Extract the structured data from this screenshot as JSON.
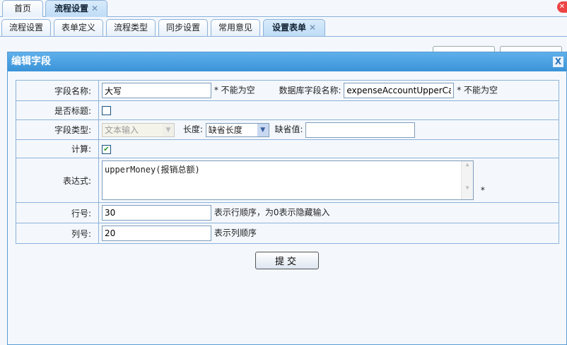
{
  "top_tabs": [
    {
      "label": "首页"
    },
    {
      "label": "流程设置",
      "active": true
    }
  ],
  "sub_tabs": [
    {
      "label": "流程设置"
    },
    {
      "label": "表单定义"
    },
    {
      "label": "流程类型"
    },
    {
      "label": "同步设置"
    },
    {
      "label": "常用意见"
    },
    {
      "label": "设置表单",
      "active": true
    }
  ],
  "close_glyph": "✕",
  "dialog": {
    "title": "编辑字段",
    "close": "X",
    "field_name_label": "字段名称:",
    "field_name_value": "大写",
    "required_note": "* 不能为空",
    "db_field_label": "数据库字段名称:",
    "db_field_value": "expenseAccountUpperCase",
    "db_required_note": "* 不能为空",
    "is_title_label": "是否标题:",
    "is_title_checked": false,
    "field_type_label": "字段类型:",
    "field_type_value": "文本输入",
    "length_label": "长度:",
    "length_value": "缺省长度",
    "default_label": "缺省值:",
    "default_value": "",
    "calc_label": "计算:",
    "calc_checked": true,
    "expr_label": "表达式:",
    "expr_value": "upperMoney(报销总额)",
    "expr_note": "*",
    "row_label": "行号:",
    "row_value": "30",
    "row_note": "表示行顺序，为0表示隐藏输入",
    "col_label": "列号:",
    "col_value": "20",
    "col_note": "表示列顺序",
    "submit": "提交"
  }
}
